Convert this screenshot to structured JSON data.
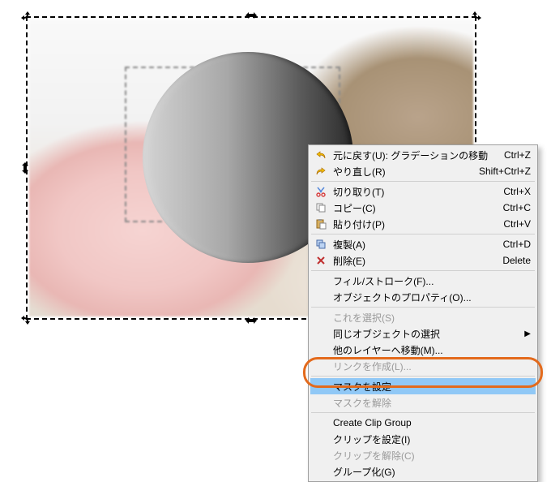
{
  "menu": {
    "undo": {
      "label": "元に戻す(U): グラデーションの移動",
      "shortcut": "Ctrl+Z"
    },
    "redo": {
      "label": "やり直し(R)",
      "shortcut": "Shift+Ctrl+Z"
    },
    "cut": {
      "label": "切り取り(T)",
      "shortcut": "Ctrl+X"
    },
    "copy": {
      "label": "コピー(C)",
      "shortcut": "Ctrl+C"
    },
    "paste": {
      "label": "貼り付け(P)",
      "shortcut": "Ctrl+V"
    },
    "duplicate": {
      "label": "複製(A)",
      "shortcut": "Ctrl+D"
    },
    "del": {
      "label": "削除(E)",
      "shortcut": "Delete"
    },
    "fillstroke": {
      "label": "フィル/ストローク(F)..."
    },
    "objprops": {
      "label": "オブジェクトのプロパティ(O)..."
    },
    "selectthis": {
      "label": "これを選択(S)"
    },
    "selectsame": {
      "label": "同じオブジェクトの選択"
    },
    "movetolayer": {
      "label": "他のレイヤーへ移動(M)..."
    },
    "createlink": {
      "label": "リンクを作成(L)..."
    },
    "setmask": {
      "label": "マスクを設定"
    },
    "releasemask": {
      "label": "マスクを解除"
    },
    "clipgroup": {
      "label": "Create Clip Group"
    },
    "setclip": {
      "label": "クリップを設定(I)"
    },
    "releaseclip": {
      "label": "クリップを解除(C)"
    },
    "group": {
      "label": "グループ化(G)"
    }
  }
}
